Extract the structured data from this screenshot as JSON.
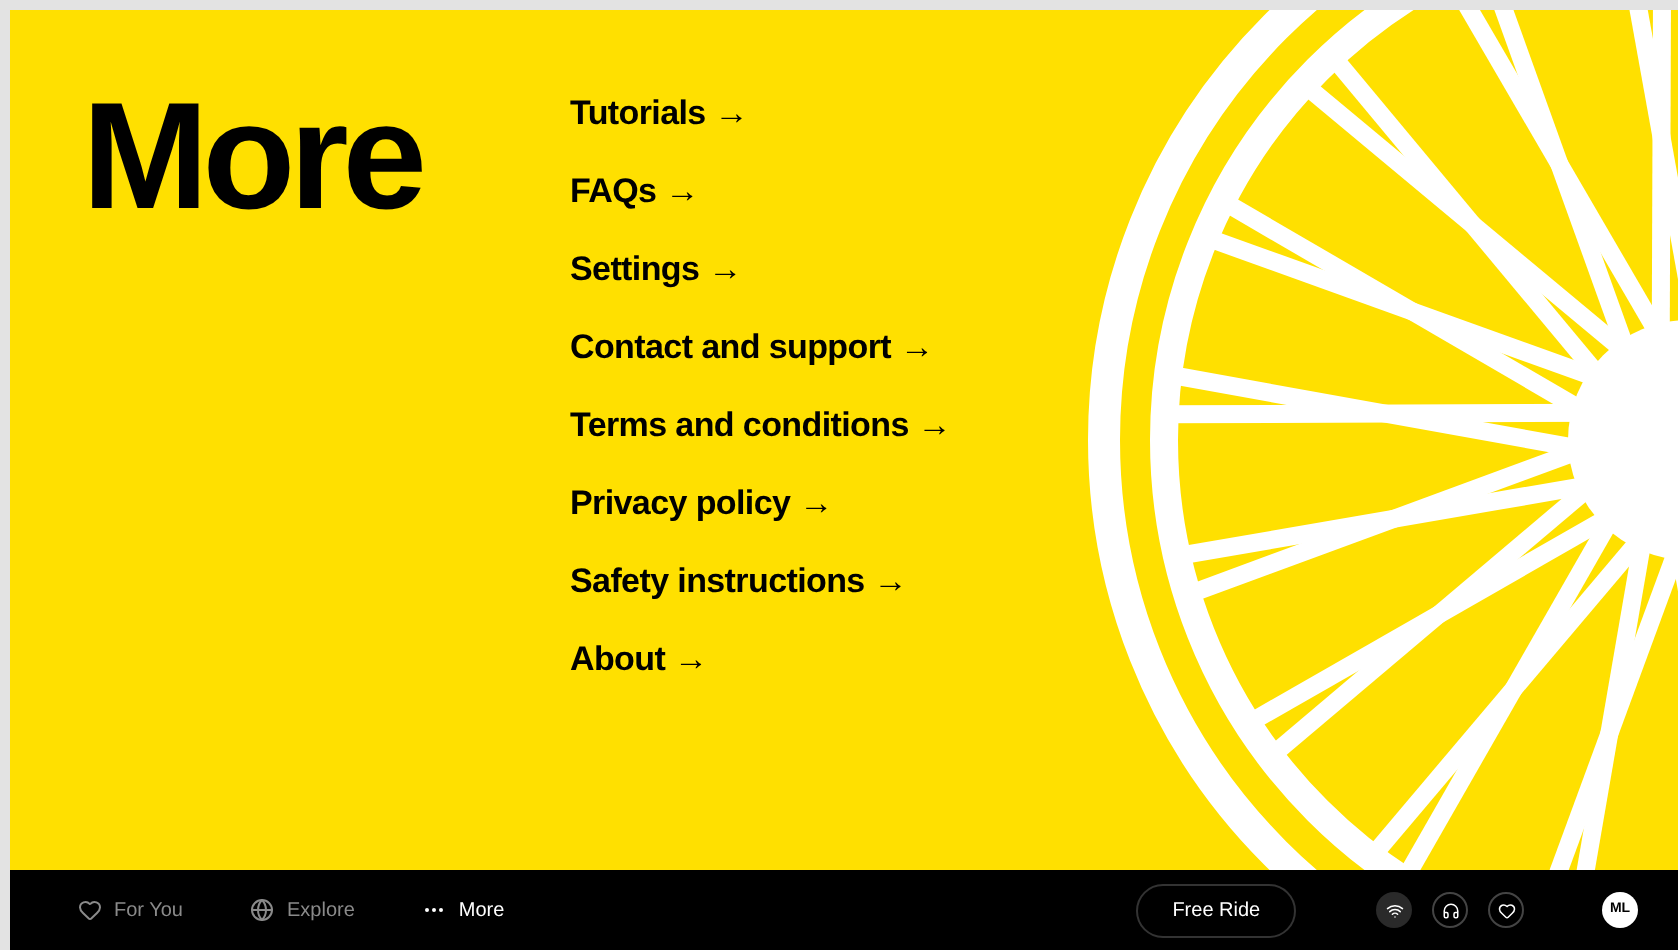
{
  "heading": "More",
  "menu": [
    "Tutorials →",
    "FAQs →",
    "Settings →",
    "Contact and support →",
    "Terms and conditions →",
    "Privacy policy →",
    "Safety instructions →",
    "About →"
  ],
  "nav": [
    {
      "label": "For You",
      "selected": false
    },
    {
      "label": "Explore",
      "selected": false
    },
    {
      "label": "More",
      "selected": true
    }
  ],
  "free_ride": "Free Ride",
  "toolbar": [
    {
      "selected": true
    },
    {
      "selected": false
    },
    {
      "selected": false
    }
  ],
  "avatar": "ML"
}
